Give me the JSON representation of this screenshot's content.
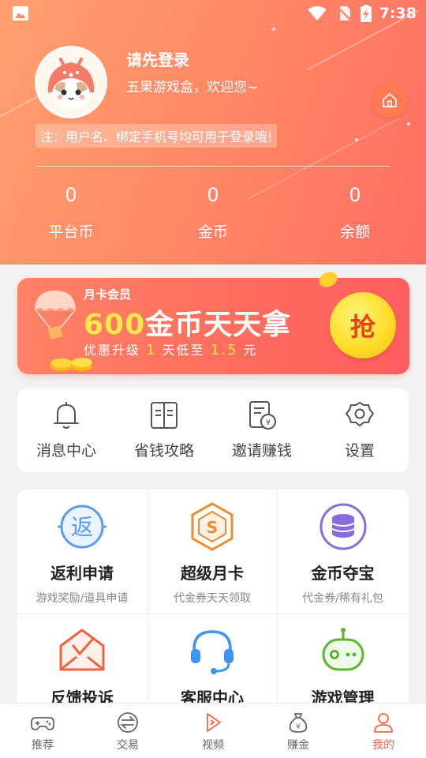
{
  "status_bar": {
    "time": "7:38"
  },
  "profile": {
    "title": "请先登录",
    "subtitle": "五果游戏盒，欢迎您~",
    "note": "注：用户名、绑定手机号均可用于登录哦!"
  },
  "stats": [
    {
      "value": "0",
      "label": "平台币"
    },
    {
      "value": "0",
      "label": "金币"
    },
    {
      "value": "0",
      "label": "余额"
    }
  ],
  "banner": {
    "tag": "月卡会员",
    "amount": "600",
    "headline": "金币天天拿",
    "line_a": "优惠升级",
    "line_b": "1",
    "line_c": "天低至",
    "line_d": "1.5",
    "line_e": "元",
    "button": "抢"
  },
  "quick_menu": [
    {
      "label": "消息中心",
      "icon": "bell-icon"
    },
    {
      "label": "省钱攻略",
      "icon": "book-icon"
    },
    {
      "label": "邀请赚钱",
      "icon": "invite-money-icon"
    },
    {
      "label": "设置",
      "icon": "gear-icon"
    }
  ],
  "services": [
    {
      "title": "返利申请",
      "sub": "游戏奖励/道具申请",
      "icon": "rebate-icon",
      "color": "#5b9cf2"
    },
    {
      "title": "超级月卡",
      "sub": "代金券天天领取",
      "icon": "monthly-card-icon",
      "color": "#f08a2c"
    },
    {
      "title": "金币夺宝",
      "sub": "代金券/稀有礼包",
      "icon": "coin-stack-icon",
      "color": "#8a6bde"
    },
    {
      "title": "反馈投诉",
      "sub": "",
      "icon": "feedback-envelope-icon",
      "color": "#f2603f"
    },
    {
      "title": "客服中心",
      "sub": "",
      "icon": "headset-icon",
      "color": "#3d95f0"
    },
    {
      "title": "游戏管理",
      "sub": "",
      "icon": "robot-controller-icon",
      "color": "#5cb52e"
    }
  ],
  "bottom_nav": [
    {
      "label": "推荐",
      "icon": "gamepad-icon",
      "active": false
    },
    {
      "label": "交易",
      "icon": "exchange-icon",
      "active": false
    },
    {
      "label": "视频",
      "icon": "video-play-icon",
      "active": false
    },
    {
      "label": "赚金",
      "icon": "money-bag-icon",
      "active": false
    },
    {
      "label": "我的",
      "icon": "user-icon",
      "active": true
    }
  ],
  "colors": {
    "accent": "#ff6148",
    "header_start": "#ff9f6e",
    "header_end": "#ff6e63"
  }
}
